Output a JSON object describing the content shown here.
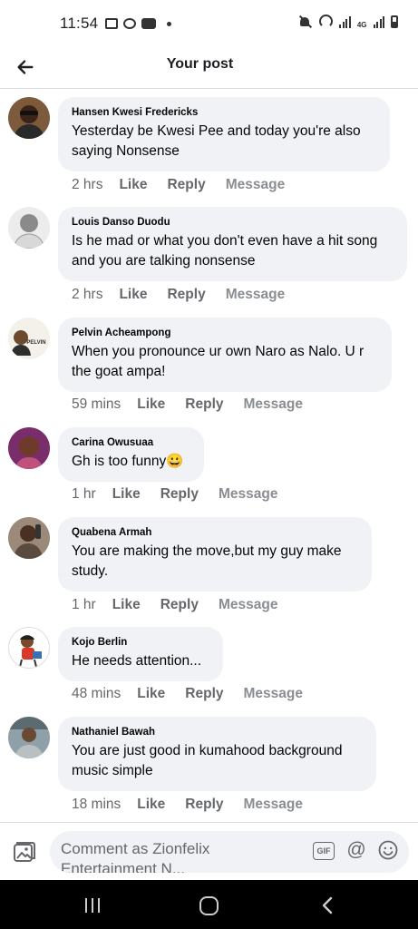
{
  "status_bar": {
    "time": "11:54",
    "network": "4G"
  },
  "header": {
    "title": "Your post"
  },
  "comments": [
    {
      "name": "Hansen Kwesi Fredericks",
      "text": "Yesterday be Kwesi Pee and today you're also saying Nonsense",
      "time": "2 hrs",
      "like": "Like",
      "reply": "Reply",
      "message": "Message"
    },
    {
      "name": "Louis Danso Duodu",
      "text": "Is he mad or what you don't even have a hit song and you are talking nonsense",
      "time": "2 hrs",
      "like": "Like",
      "reply": "Reply",
      "message": "Message"
    },
    {
      "name": "Pelvin Acheampong",
      "text": "When you pronounce ur own Naro as Nalo. U r the goat ampa!",
      "time": "59 mins",
      "like": "Like",
      "reply": "Reply",
      "message": "Message",
      "avatar_text": "PELVIN"
    },
    {
      "name": "Carina Owusuaa",
      "text": "Gh is too funny😀",
      "time": "1 hr",
      "like": "Like",
      "reply": "Reply",
      "message": "Message"
    },
    {
      "name": "Quabena Armah",
      "text": "You are making the move,but my guy make study.",
      "time": "1 hr",
      "like": "Like",
      "reply": "Reply",
      "message": "Message"
    },
    {
      "name": "Kojo Berlin",
      "text": "He needs attention...",
      "time": "48 mins",
      "like": "Like",
      "reply": "Reply",
      "message": "Message"
    },
    {
      "name": "Nathaniel Bawah",
      "text": "You are just good in kumahood background music simple",
      "time": "18 mins",
      "like": "Like",
      "reply": "Reply",
      "message": "Message"
    }
  ],
  "composer": {
    "placeholder": "Comment as Zionfelix Entertainment N...",
    "gif_label": "GIF",
    "at_label": "@"
  },
  "colors": {
    "bubble": "#f0f2f5",
    "secondary_text": "#65676b",
    "nav_bar": "#000000"
  }
}
